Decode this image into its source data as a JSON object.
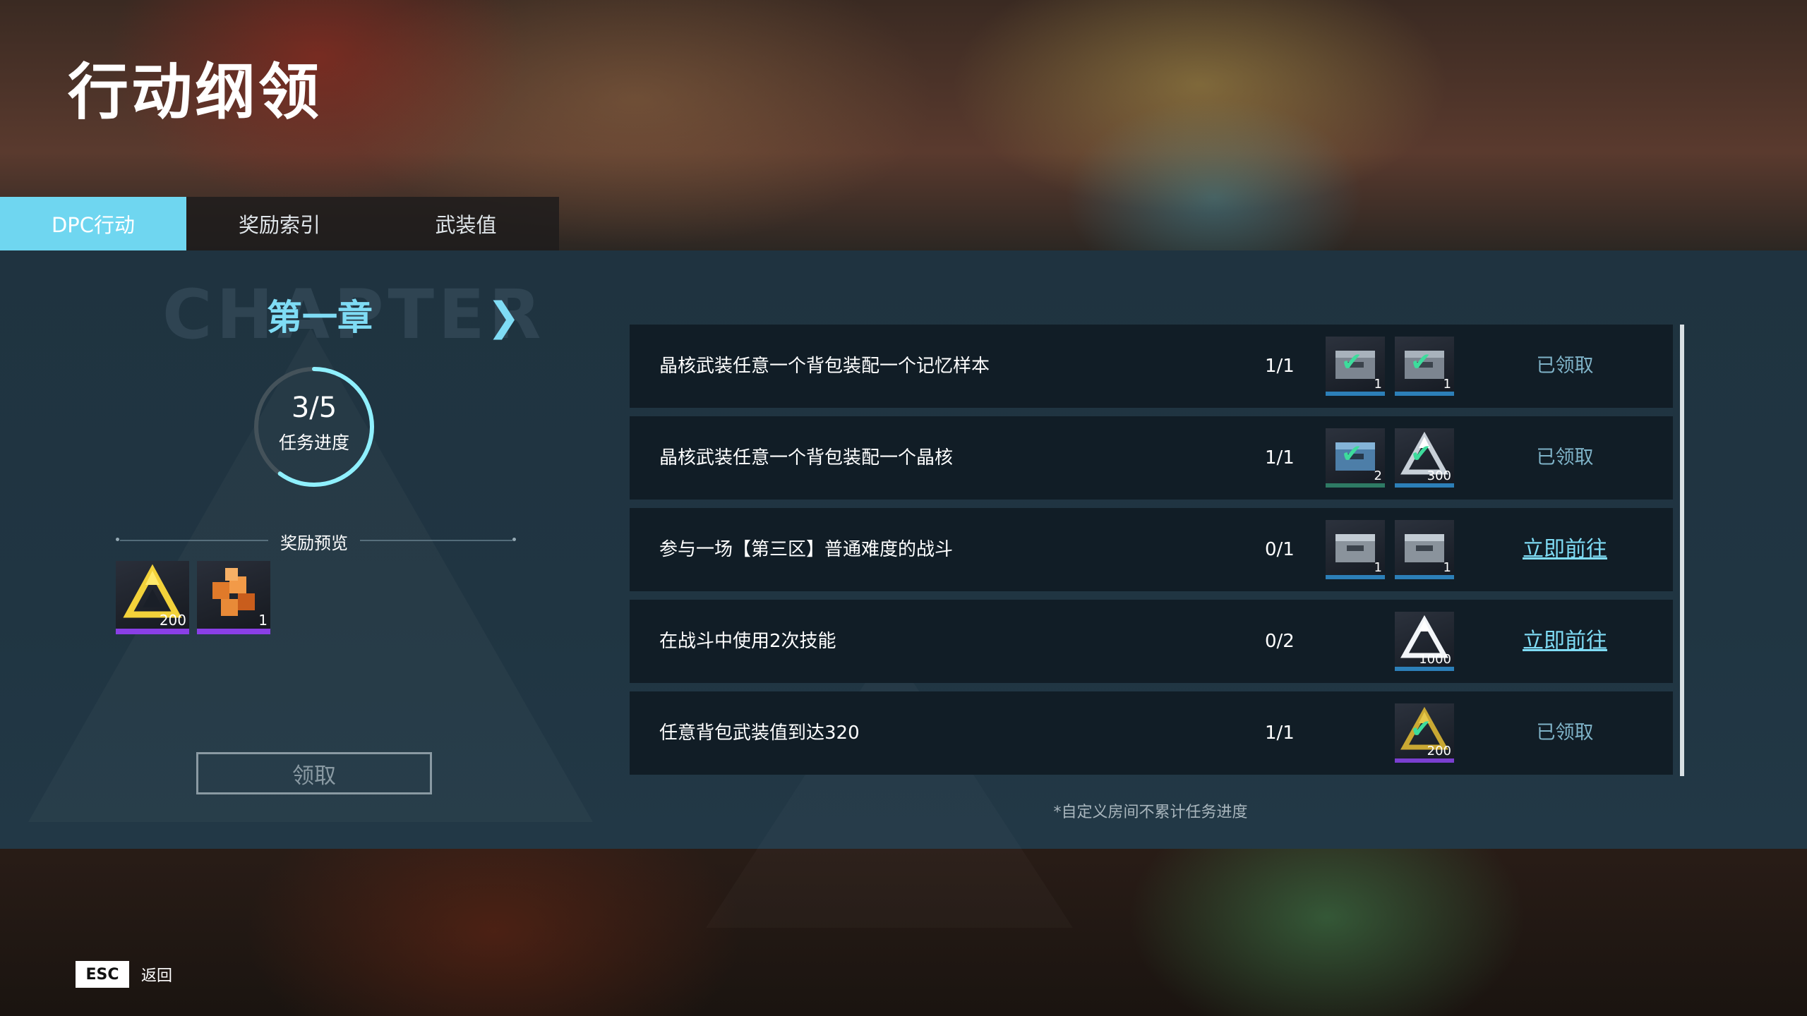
{
  "page": {
    "title": "行动纲领"
  },
  "tabs": [
    {
      "label": "DPC行动",
      "active": true
    },
    {
      "label": "奖励索引",
      "active": false
    },
    {
      "label": "武装值",
      "active": false
    }
  ],
  "chapter": {
    "bg_text": "CHAPTER",
    "label": "第一章",
    "next_icon": "chevron-right-icon"
  },
  "progress": {
    "text": "3/5",
    "label": "任务进度",
    "completed": 3,
    "total": 5
  },
  "preview": {
    "label": "奖励预览",
    "items": [
      {
        "icon": "triangle-emblem-icon",
        "qty": "200",
        "color": "#8a3fe6"
      },
      {
        "icon": "cube-cluster-icon",
        "qty": "1",
        "color": "#8a3fe6"
      }
    ]
  },
  "claim_button": {
    "label": "领取"
  },
  "tasks": [
    {
      "name": "晶核武装任意一个背包装配一个记忆样本",
      "progress": "1/1",
      "rewards": [
        {
          "icon": "crate-icon",
          "qty": "1",
          "claimed": true,
          "bar": "#2c7fb8"
        },
        {
          "icon": "crate-icon",
          "qty": "1",
          "claimed": true,
          "bar": "#2c7fb8"
        }
      ],
      "action": "已领取",
      "action_type": "done"
    },
    {
      "name": "晶核武装任意一个背包装配一个晶核",
      "progress": "1/1",
      "rewards": [
        {
          "icon": "crate-blue-icon",
          "qty": "2",
          "claimed": true,
          "bar": "#2e7a64"
        },
        {
          "icon": "triangle-emblem-icon",
          "qty": "300",
          "claimed": true,
          "bar": "#2c7fb8"
        }
      ],
      "action": "已领取",
      "action_type": "done"
    },
    {
      "name": "参与一场【第三区】普通难度的战斗",
      "progress": "0/1",
      "rewards": [
        {
          "icon": "crate-icon",
          "qty": "1",
          "claimed": false,
          "bar": "#2c7fb8"
        },
        {
          "icon": "crate-icon",
          "qty": "1",
          "claimed": false,
          "bar": "#2c7fb8"
        }
      ],
      "action": "立即前往",
      "action_type": "go"
    },
    {
      "name": "在战斗中使用2次技能",
      "progress": "0/2",
      "rewards": [
        {
          "icon": "triangle-emblem-icon",
          "qty": "1000",
          "claimed": false,
          "bar": "#2c7fb8"
        }
      ],
      "action": "立即前往",
      "action_type": "go"
    },
    {
      "name": "任意背包武装值到达320",
      "progress": "1/1",
      "rewards": [
        {
          "icon": "triangle-emblem-gold-icon",
          "qty": "200",
          "claimed": true,
          "bar": "#7a3fd0"
        }
      ],
      "action": "已领取",
      "action_type": "done"
    }
  ],
  "note": "*自定义房间不累计任务进度",
  "footer": {
    "key": "ESC",
    "label": "返回"
  }
}
